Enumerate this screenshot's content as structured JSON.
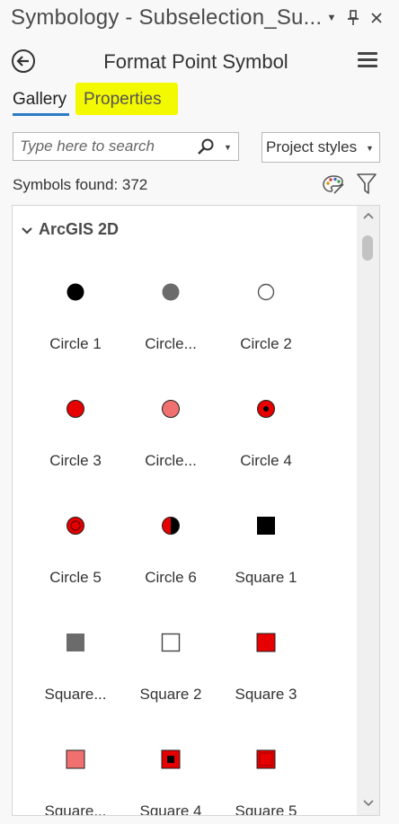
{
  "window": {
    "title": "Symbology - Subselection_Su...",
    "dropdown_icon": "chevron-down-icon",
    "pin_icon": "pin-icon",
    "close_icon": "close-icon"
  },
  "header": {
    "title": "Format Point Symbol",
    "back_icon": "back-arrow-circle-icon",
    "menu_icon": "hamburger-menu-icon"
  },
  "tabs": [
    {
      "label": "Gallery",
      "active": true
    },
    {
      "label": "Properties",
      "active": false,
      "highlight": "#f3f900"
    }
  ],
  "search": {
    "placeholder": "Type here to search",
    "value": "",
    "icon": "search-icon"
  },
  "styles_dropdown": {
    "selected": "Project styles"
  },
  "results": {
    "count_text": "Symbols found: 372"
  },
  "gallery": {
    "group": "ArcGIS 2D",
    "symbols": [
      {
        "label": "Circle 1"
      },
      {
        "label": "Circle..."
      },
      {
        "label": "Circle 2"
      },
      {
        "label": "Circle 3"
      },
      {
        "label": "Circle..."
      },
      {
        "label": "Circle 4"
      },
      {
        "label": "Circle 5"
      },
      {
        "label": "Circle 6"
      },
      {
        "label": "Square 1"
      },
      {
        "label": "Square..."
      },
      {
        "label": "Square 2"
      },
      {
        "label": "Square 3"
      },
      {
        "label": "Square..."
      },
      {
        "label": "Square 4"
      },
      {
        "label": "Square 5"
      }
    ]
  },
  "colors": {
    "accent": "#2b7bc5",
    "symbol_red": "#e60000",
    "symbol_light_red": "#f07070",
    "symbol_gray": "#6b6b6b"
  }
}
